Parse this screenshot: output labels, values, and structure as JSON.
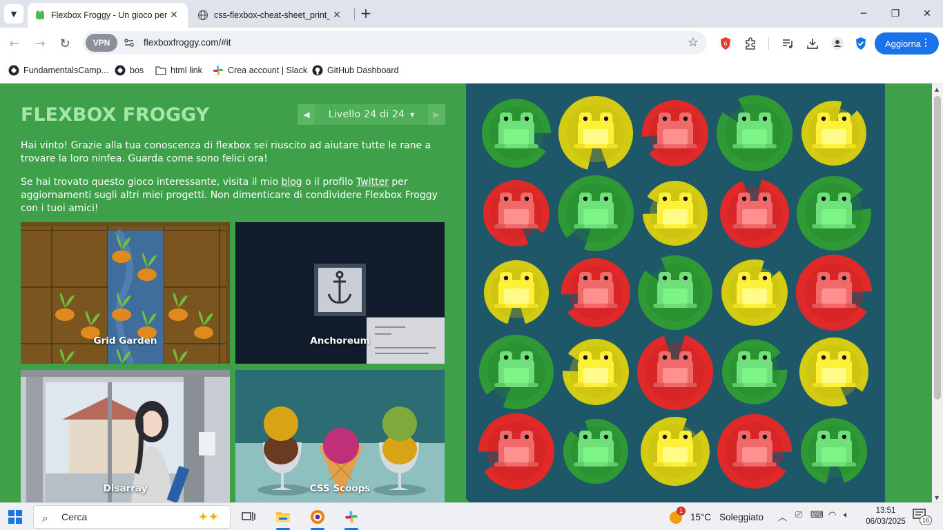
{
  "browser": {
    "tabs": [
      {
        "title": "Flexbox Froggy - Un gioco per i",
        "active": true
      },
      {
        "title": "css-flexbox-cheat-sheet_print_b",
        "active": false
      }
    ],
    "url": "flexboxfroggy.com/#it",
    "vpn_label": "VPN",
    "update_label": "Aggiorna",
    "shield_badge": "6",
    "bookmarks": [
      "FundamentalsCamp...",
      "bos",
      "html link",
      "Crea account | Slack",
      "GitHub Dashboard"
    ]
  },
  "game": {
    "logo": "FLEXBOX FROGGY",
    "level_label": "Livello 24 di 24",
    "win_message": "Hai vinto! Grazie alla tua conoscenza di flexbox sei riuscito ad aiutare tutte le rane a trovare la loro ninfea. Guarda come sono felici ora!",
    "promo": {
      "before_blog": "Se hai trovato questo gioco interessante, visita il mio ",
      "blog": "blog",
      "middle": " o il profilo ",
      "twitter": "Twitter",
      "after": " per aggiornamenti sugli altri miei progetti. Non dimenticare di condividere Flexbox Froggy con i tuoi amici!"
    },
    "projects": [
      "Grid Garden",
      "Anchoreum",
      "Disarray",
      "CSS Scoops"
    ]
  },
  "pond": {
    "colors": {
      "green": "#2f9a35",
      "yellow": "#d4cc12",
      "red": "#e02a2a",
      "bg": "#1e5768"
    },
    "rows": [
      [
        "green",
        "yellow",
        "red",
        "green",
        "yellow"
      ],
      [
        "red",
        "green",
        "yellow",
        "red",
        "green"
      ],
      [
        "yellow",
        "red",
        "green",
        "yellow",
        "red"
      ],
      [
        "green",
        "yellow",
        "red",
        "green",
        "yellow"
      ],
      [
        "red",
        "green",
        "yellow",
        "red",
        "green"
      ]
    ]
  },
  "taskbar": {
    "search_placeholder": "Cerca",
    "weather_temp": "15°C",
    "weather_desc": "Soleggiato",
    "weather_badge": "1",
    "time": "13:51",
    "date": "06/03/2025",
    "notif_count": "16"
  }
}
